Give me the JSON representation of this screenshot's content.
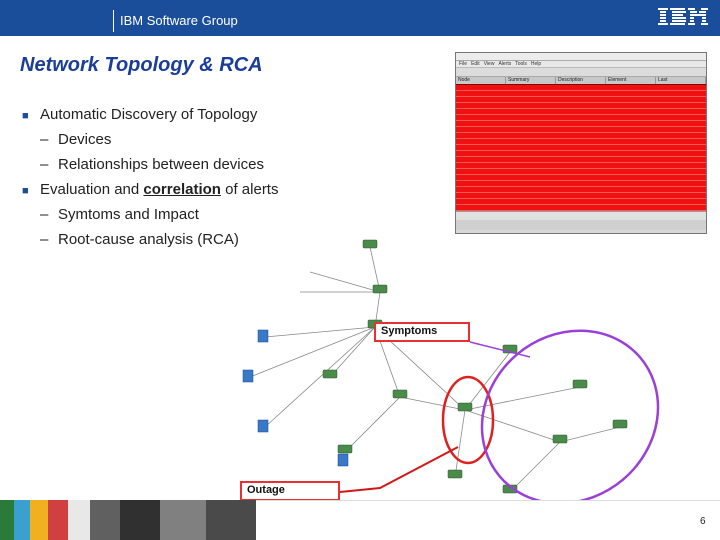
{
  "header": {
    "group": "IBM Software Group",
    "logo_text": "IBM"
  },
  "slide": {
    "title": "Network Topology & RCA",
    "page_number": "6"
  },
  "bullets": [
    {
      "text": "Automatic Discovery of Topology",
      "subs": [
        "Devices",
        "Relationships between devices"
      ]
    },
    {
      "text_before": "Evaluation and ",
      "text_emph": "correlation",
      "text_after": " of alerts",
      "subs": [
        "Symtoms and Impact",
        "Root-cause analysis (RCA)"
      ]
    }
  ],
  "callouts": {
    "symptoms": "Symptoms",
    "outage": "Outage"
  },
  "colors": {
    "brand_blue": "#1a4e9a",
    "title_blue": "#1a3d9a",
    "alert_red": "#ee1111",
    "callout_red": "#e83030",
    "symptom_ring": "#9a40d8",
    "outage_ring": "#e02020"
  },
  "alert_window": {
    "menu": [
      "File",
      "Edit",
      "View",
      "Alerts",
      "Tools",
      "Help"
    ],
    "columns": [
      "Node",
      "Summary",
      "Description",
      "Element",
      "Last"
    ]
  }
}
